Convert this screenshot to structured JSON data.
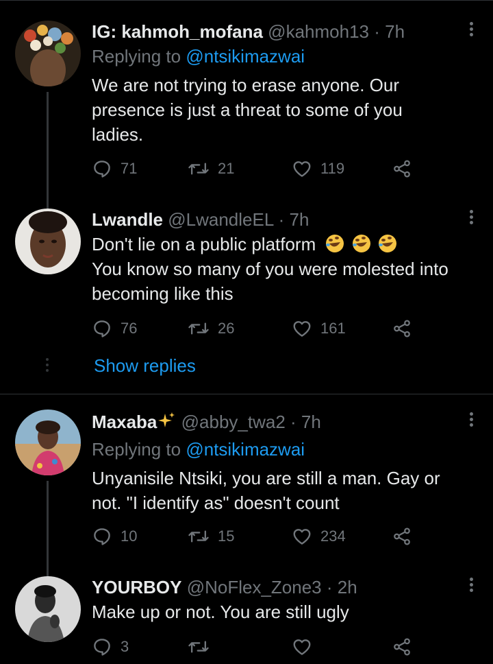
{
  "tweets": [
    {
      "name": "IG: kahmoh_mofana",
      "handle": "@kahmoh13",
      "time": "7h",
      "replying_prefix": "Replying to",
      "replying_to": "@ntsikimazwai",
      "lines": [
        "We are not trying to erase anyone. Our",
        "presence is just a threat to some of you",
        "ladies."
      ],
      "replies": "71",
      "retweets": "21",
      "likes": "119"
    },
    {
      "name": "Lwandle",
      "handle": "@LwandleEL",
      "time": "7h",
      "lines": [
        "Don't lie on a public platform",
        "You know so many of you were molested into",
        "becoming like this"
      ],
      "replies": "76",
      "retweets": "26",
      "likes": "161",
      "show_replies": "Show replies"
    },
    {
      "name": "Maxaba",
      "handle": "@abby_twa2",
      "time": "7h",
      "replying_prefix": "Replying to",
      "replying_to": "@ntsikimazwai",
      "lines": [
        "Unyanisile Ntsiki, you are still a man. Gay or",
        "not.  \"I identify as\" doesn't count"
      ],
      "replies": "10",
      "retweets": "15",
      "likes": "234"
    },
    {
      "name": "YOURBOY",
      "handle": "@NoFlex_Zone3",
      "time": "2h",
      "lines": [
        "Make up or not. You are still ugly"
      ],
      "replies": "3"
    }
  ],
  "separator": "·",
  "colors": {
    "background": "#000000",
    "text": "#e7e9ea",
    "secondary": "#71767b",
    "link": "#1d9bf0",
    "divider": "#2f3336"
  },
  "icons": [
    "reply-icon",
    "retweet-icon",
    "like-icon",
    "share-icon",
    "more-icon",
    "rolling-laughing-emoji",
    "sparkles-emoji"
  ]
}
